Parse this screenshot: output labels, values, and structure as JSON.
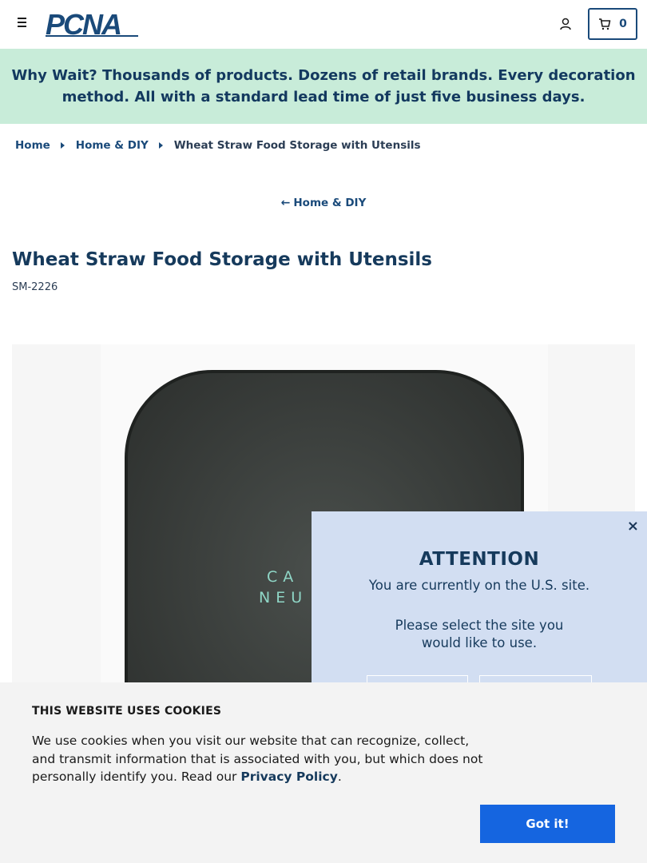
{
  "header": {
    "logo_text": "PCNA",
    "cart_count": "0",
    "brand_color": "#1a4a7a"
  },
  "banner": {
    "lead": "Why Wait?",
    "text": "Thousands of products. Dozens of retail brands. Every decoration method. All with a standard lead time of just five business days.",
    "bg_color": "#c8ecd9"
  },
  "breadcrumb": {
    "items": [
      "Home",
      "Home & DIY"
    ],
    "current": "Wheat Straw Food Storage with Utensils"
  },
  "back_link": {
    "arrow": "←",
    "label": "Home & DIY"
  },
  "product": {
    "title": "Wheat Straw Food Storage with Utensils",
    "sku": "SM-2226",
    "image_text": [
      "CA",
      "NEU"
    ]
  },
  "region_modal": {
    "close": "×",
    "title": "ATTENTION",
    "text1": "You are currently on the U.S. site.",
    "text2": "Please select the site you would like to use."
  },
  "cookie": {
    "title": "THIS WEBSITE USES COOKIES",
    "text": "We use cookies when you visit our website that can recognize, collect, and transmit information that is associated with you, but which does not personally identify you. Read our",
    "link_label": "Privacy Policy",
    "period": ".",
    "button_label": "Got it!",
    "button_color": "#1565e0"
  }
}
